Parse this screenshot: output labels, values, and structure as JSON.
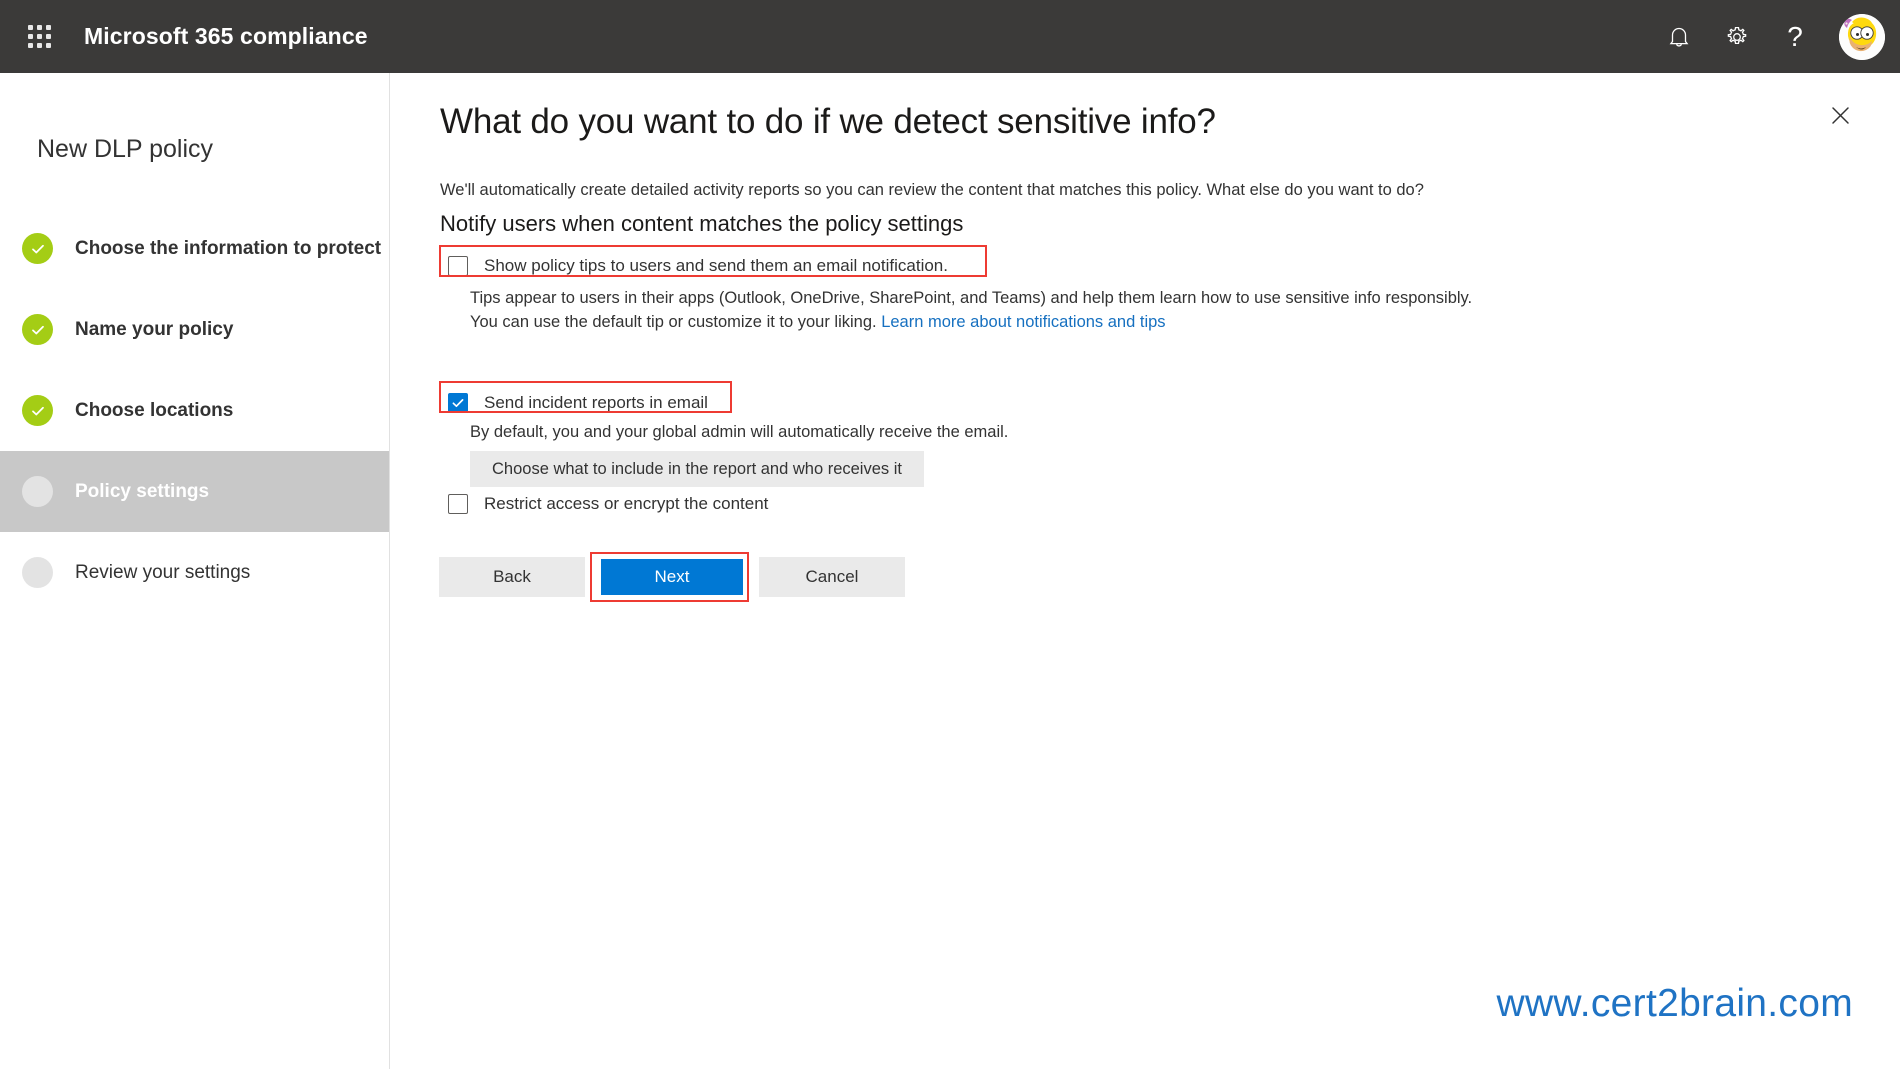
{
  "header": {
    "waffle_icon": "app-launcher-grid-icon",
    "title": "Microsoft 365 compliance",
    "notification_icon": "bell-icon",
    "settings_icon": "gear-icon",
    "help_icon": "question-mark-icon",
    "avatar_icon": "user-avatar"
  },
  "sidebar": {
    "title": "New DLP policy",
    "steps": [
      {
        "label": "Choose the information to protect",
        "state": "done"
      },
      {
        "label": "Name your policy",
        "state": "done"
      },
      {
        "label": "Choose locations",
        "state": "done"
      },
      {
        "label": "Policy settings",
        "state": "current"
      },
      {
        "label": "Review your settings",
        "state": "upcoming"
      }
    ]
  },
  "main": {
    "close_icon": "close-icon",
    "title": "What do you want to do if we detect sensitive info?",
    "description": "We'll automatically create detailed activity reports so you can review the content that matches this policy. What else do you want to do?",
    "section_heading": "Notify users when content matches the policy settings",
    "policy_tips": {
      "checkbox_label": "Show policy tips to users and send them an email notification.",
      "checked": false,
      "help_line_1": "Tips appear to users in their apps (Outlook, OneDrive, SharePoint, and Teams) and help them learn how to use sensitive info responsibly.",
      "help_line_2": "You can use the default tip or customize it to your liking. ",
      "link_text": "Learn more about notifications and tips"
    },
    "incident_reports": {
      "checkbox_label": "Send incident reports in email",
      "checked": true,
      "help_text": "By default, you and your global admin will automatically receive the email.",
      "configure_button": "Choose what to include in the report and who receives it"
    },
    "restrict_access": {
      "checkbox_label": "Restrict access or encrypt the content",
      "checked": false
    },
    "buttons": {
      "back": "Back",
      "next": "Next",
      "cancel": "Cancel"
    }
  },
  "watermark": "www.cert2brain.com",
  "colors": {
    "header_bg": "#3b3a39",
    "accent_blue": "#0078d4",
    "link_blue": "#1670c0",
    "step_done_green": "#a4cd15",
    "active_step_bg": "#c8c8c8",
    "annotation_red": "#ee3b33",
    "watermark_blue": "#1f73c4"
  }
}
